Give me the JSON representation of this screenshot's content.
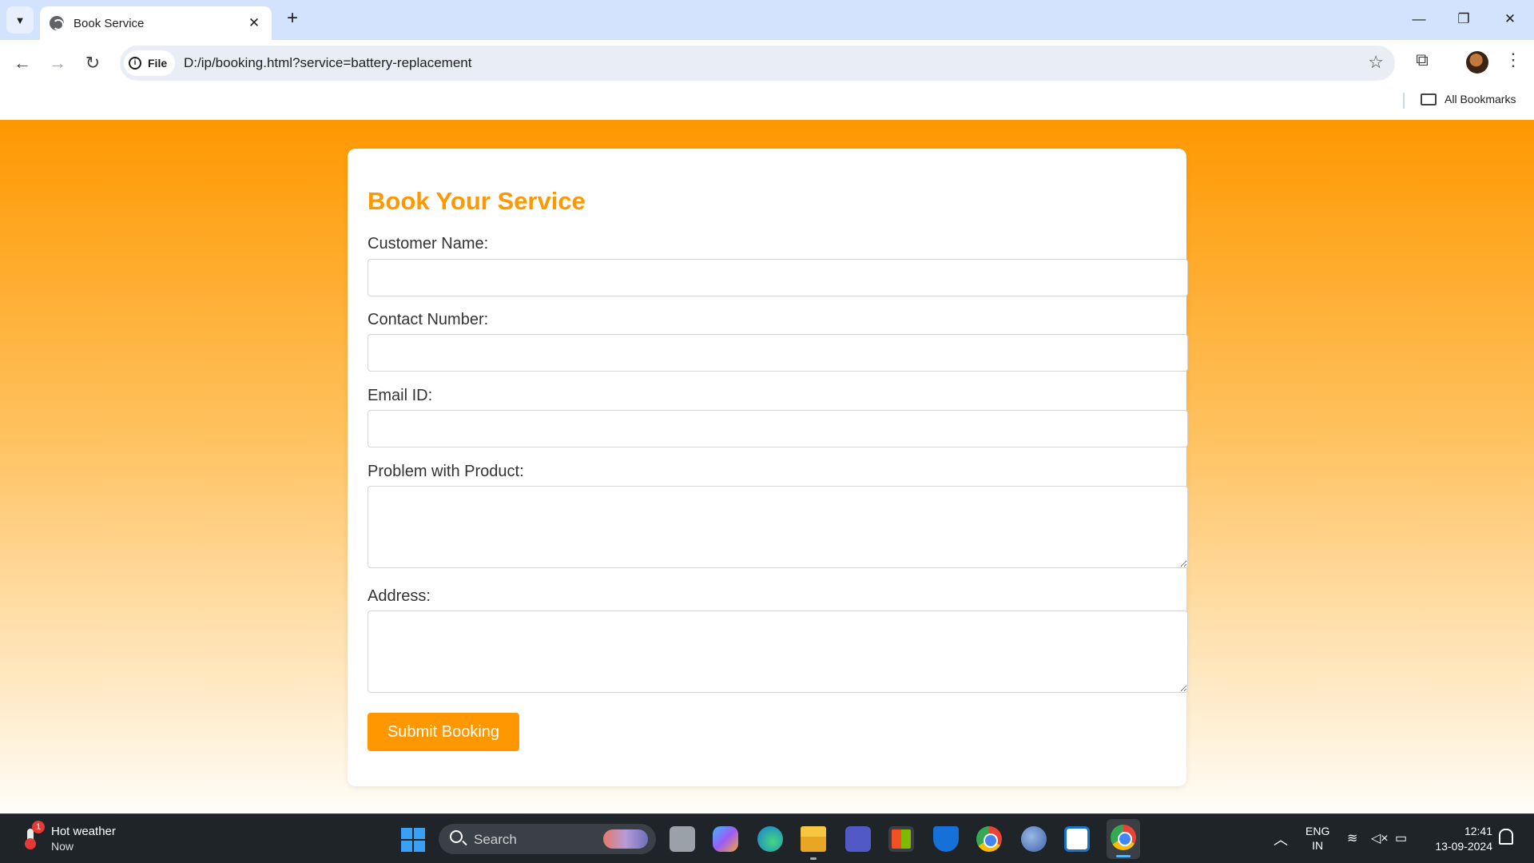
{
  "browser": {
    "tab_title": "Book Service",
    "tab_close": "✕",
    "new_tab": "+",
    "chip_label": "File",
    "url": "D:/ip/booking.html?service=battery-replacement",
    "bookmarks_label": "All Bookmarks",
    "icons": [
      "tab-search-icon",
      "globe-icon",
      "back-arrow-icon",
      "forward-arrow-icon",
      "reload-icon",
      "info-icon",
      "star-icon",
      "extensions-icon",
      "more-icon",
      "folder-icon"
    ]
  },
  "form": {
    "heading": "Book Your Service",
    "fields": [
      {
        "label": "Customer Name:",
        "value": ""
      },
      {
        "label": "Contact Number:",
        "value": ""
      },
      {
        "label": "Email ID:",
        "value": ""
      },
      {
        "label": "Problem with Product:",
        "value": ""
      },
      {
        "label": "Address:",
        "value": ""
      }
    ],
    "submit_label": "Submit Booking",
    "accent_color": "#ff9800"
  },
  "taskbar": {
    "weather_title": "Hot weather",
    "weather_sub": "Now",
    "weather_badge": "1",
    "search_placeholder": "Search",
    "lang_primary": "ENG",
    "lang_secondary": "IN",
    "time": "12:41",
    "date": "13-09-2024"
  }
}
